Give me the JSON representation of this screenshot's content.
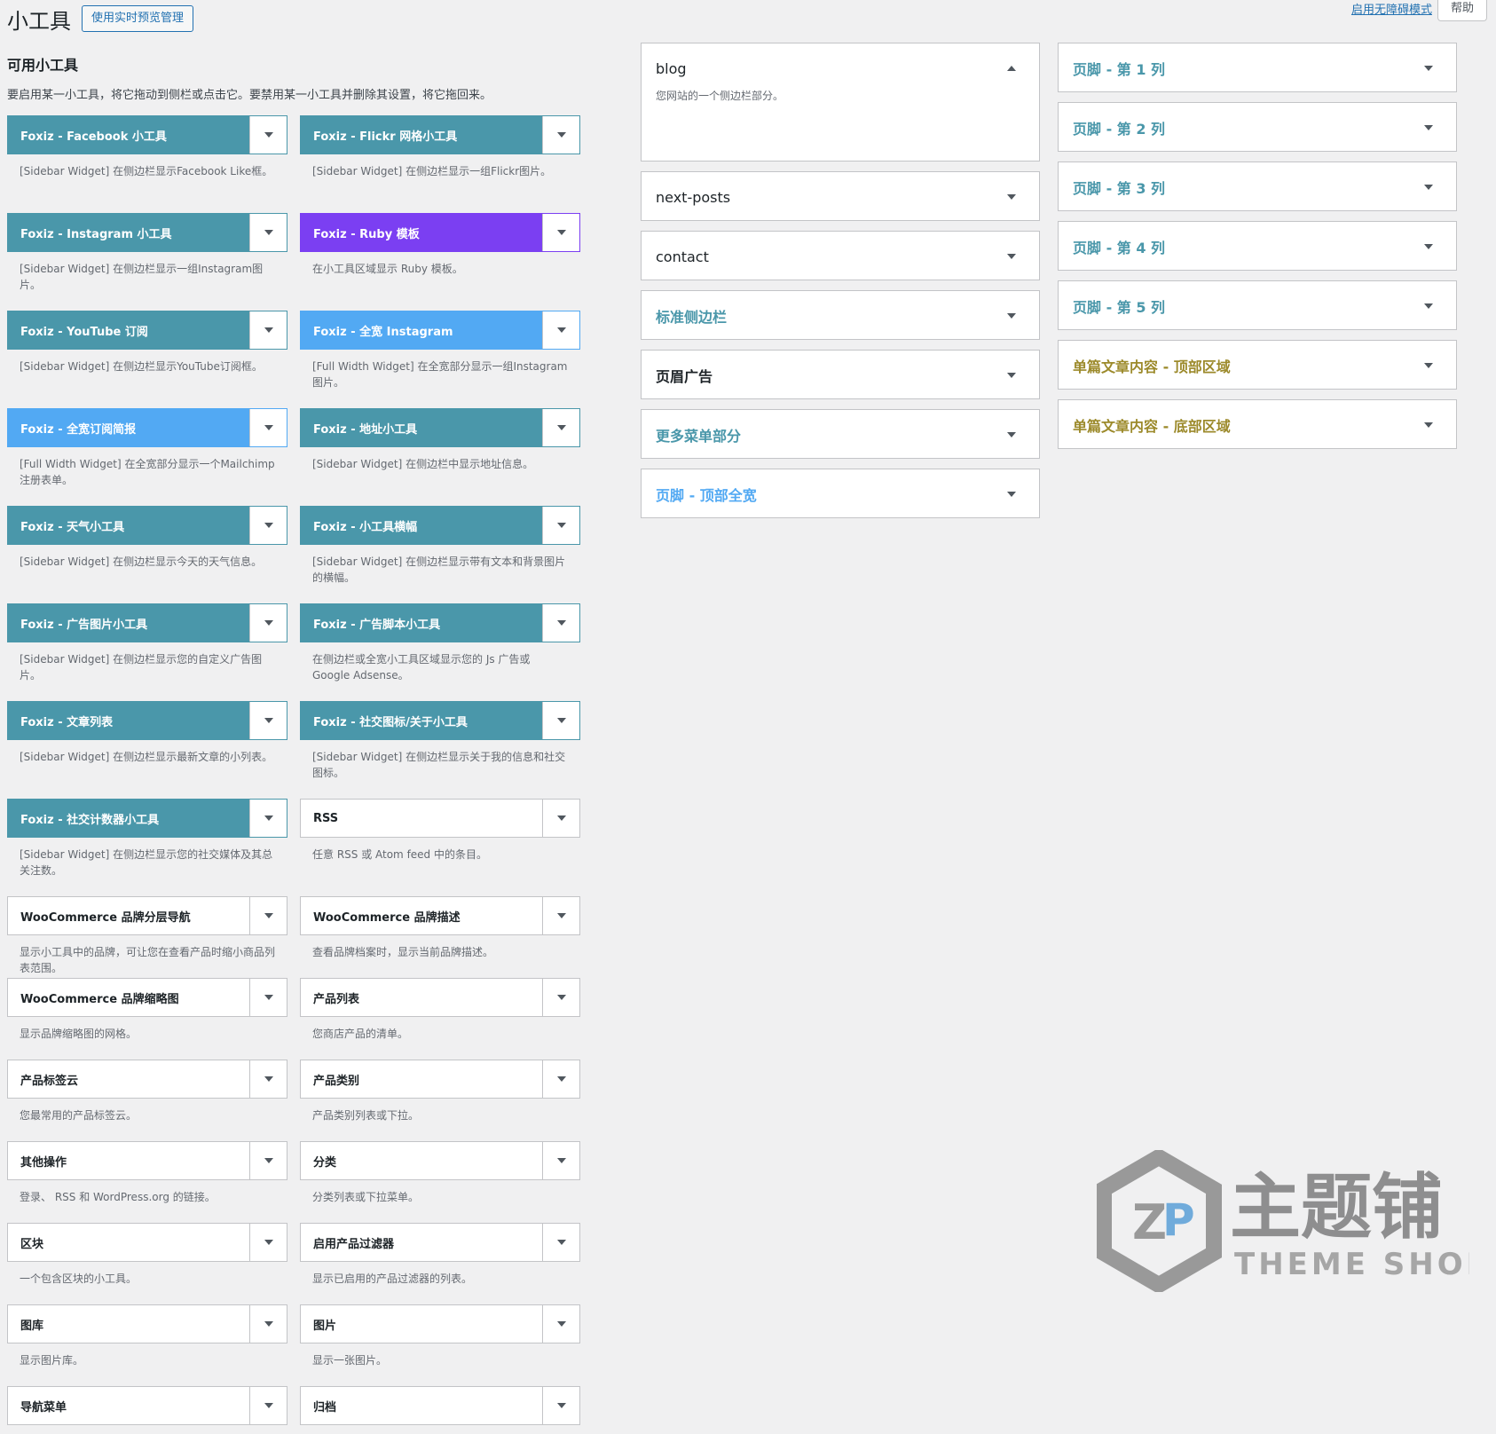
{
  "header": {
    "title": "小工具",
    "preview_button": "使用实时预览管理",
    "a11y_link": "启用无障碍模式",
    "help_tab": "帮助"
  },
  "available": {
    "title": "可用小工具",
    "description": "要启用某一小工具，将它拖动到侧栏或点击它。要禁用某一小工具并删除其设置，将它拖回来。",
    "widgets": [
      {
        "title": "Foxiz - Facebook 小工具",
        "desc": "[Sidebar Widget] 在侧边栏显示Facebook Like框。",
        "style": "teal"
      },
      {
        "title": "Foxiz - Flickr 网格小工具",
        "desc": "[Sidebar Widget] 在侧边栏显示一组Flickr图片。",
        "style": "teal"
      },
      {
        "title": "Foxiz - Instagram 小工具",
        "desc": "[Sidebar Widget] 在侧边栏显示一组Instagram图片。",
        "style": "teal"
      },
      {
        "title": "Foxiz - Ruby 模板",
        "desc": "在小工具区域显示 Ruby 模板。",
        "style": "purple"
      },
      {
        "title": "Foxiz - YouTube 订阅",
        "desc": "[Sidebar Widget] 在侧边栏显示YouTube订阅框。",
        "style": "teal"
      },
      {
        "title": "Foxiz - 全宽 Instagram",
        "desc": "[Full Width Widget] 在全宽部分显示一组Instagram图片。",
        "style": "sky"
      },
      {
        "title": "Foxiz - 全宽订阅简报",
        "desc": "[Full Width Widget] 在全宽部分显示一个Mailchimp注册表单。",
        "style": "sky"
      },
      {
        "title": "Foxiz - 地址小工具",
        "desc": "[Sidebar Widget] 在侧边栏中显示地址信息。",
        "style": "teal"
      },
      {
        "title": "Foxiz - 天气小工具",
        "desc": "[Sidebar Widget] 在侧边栏显示今天的天气信息。",
        "style": "teal"
      },
      {
        "title": "Foxiz - 小工具横幅",
        "desc": "[Sidebar Widget] 在侧边栏显示带有文本和背景图片的横幅。",
        "style": "teal"
      },
      {
        "title": "Foxiz - 广告图片小工具",
        "desc": "[Sidebar Widget] 在侧边栏显示您的自定义广告图片。",
        "style": "teal"
      },
      {
        "title": "Foxiz - 广告脚本小工具",
        "desc": "在侧边栏或全宽小工具区域显示您的 Js 广告或 Google Adsense。",
        "style": "teal"
      },
      {
        "title": "Foxiz - 文章列表",
        "desc": "[Sidebar Widget] 在侧边栏显示最新文章的小列表。",
        "style": "teal"
      },
      {
        "title": "Foxiz - 社交图标/关于小工具",
        "desc": "[Sidebar Widget] 在侧边栏显示关于我的信息和社交图标。",
        "style": "teal"
      },
      {
        "title": "Foxiz - 社交计数器小工具",
        "desc": "[Sidebar Widget] 在侧边栏显示您的社交媒体及其总关注数。",
        "style": "teal"
      },
      {
        "title": "RSS",
        "desc": "任意 RSS 或 Atom feed 中的条目。",
        "style": "plain"
      },
      {
        "title": "WooCommerce 品牌分层导航",
        "desc": "显示小工具中的品牌，可让您在查看产品时缩小商品列表范围。",
        "style": "plain"
      },
      {
        "title": "WooCommerce 品牌描述",
        "desc": "查看品牌档案时，显示当前品牌描述。",
        "style": "plain"
      },
      {
        "title": "WooCommerce 品牌缩略图",
        "desc": "显示品牌缩略图的网格。",
        "style": "plain"
      },
      {
        "title": "产品列表",
        "desc": "您商店产品的清单。",
        "style": "plain"
      },
      {
        "title": "产品标签云",
        "desc": "您最常用的产品标签云。",
        "style": "plain"
      },
      {
        "title": "产品类别",
        "desc": "产品类别列表或下拉。",
        "style": "plain"
      },
      {
        "title": "其他操作",
        "desc": "登录、 RSS 和 WordPress.org 的链接。",
        "style": "plain"
      },
      {
        "title": "分类",
        "desc": "分类列表或下拉菜单。",
        "style": "plain"
      },
      {
        "title": "区块",
        "desc": "一个包含区块的小工具。",
        "style": "plain"
      },
      {
        "title": "启用产品过滤器",
        "desc": "显示已启用的产品过滤器的列表。",
        "style": "plain"
      },
      {
        "title": "图库",
        "desc": "显示图片库。",
        "style": "plain"
      },
      {
        "title": "图片",
        "desc": "显示一张图片。",
        "style": "plain"
      },
      {
        "title": "导航菜单",
        "desc": "",
        "style": "plain"
      },
      {
        "title": "归档",
        "desc": "",
        "style": "plain"
      }
    ]
  },
  "sidebars_col1": [
    {
      "name": "blog",
      "desc": "您网站的一个侧边栏部分。",
      "color": "default",
      "open": true
    },
    {
      "name": "next-posts",
      "desc": "",
      "color": "default",
      "open": false
    },
    {
      "name": "contact",
      "desc": "",
      "color": "default",
      "open": false
    },
    {
      "name": "标准侧边栏",
      "desc": "",
      "color": "blue",
      "open": false
    },
    {
      "name": "页眉广告",
      "desc": "",
      "color": "dark",
      "open": false
    },
    {
      "name": "更多菜单部分",
      "desc": "",
      "color": "blue",
      "open": false
    },
    {
      "name": "页脚 - 顶部全宽",
      "desc": "",
      "color": "sky",
      "open": false
    }
  ],
  "sidebars_col2": [
    {
      "name": "页脚 - 第 1 列",
      "color": "blue"
    },
    {
      "name": "页脚 - 第 2 列",
      "color": "blue"
    },
    {
      "name": "页脚 - 第 3 列",
      "color": "blue"
    },
    {
      "name": "页脚 - 第 4 列",
      "color": "blue"
    },
    {
      "name": "页脚 - 第 5 列",
      "color": "blue"
    },
    {
      "name": "单篇文章内容 - 顶部区域",
      "color": "gold"
    },
    {
      "name": "单篇文章内容 - 底部区域",
      "color": "gold"
    }
  ],
  "watermark": {
    "brand": "主题铺",
    "sub": "THEME SHOP"
  },
  "colors": {
    "teal": "#4a97aa",
    "purple": "#7b3ff2",
    "sky": "#52a9f3",
    "gold": "#9c8a2b",
    "link": "#2271b1"
  },
  "icons": {
    "toggle": "caret-down-icon",
    "toggle_open": "caret-up-icon"
  }
}
